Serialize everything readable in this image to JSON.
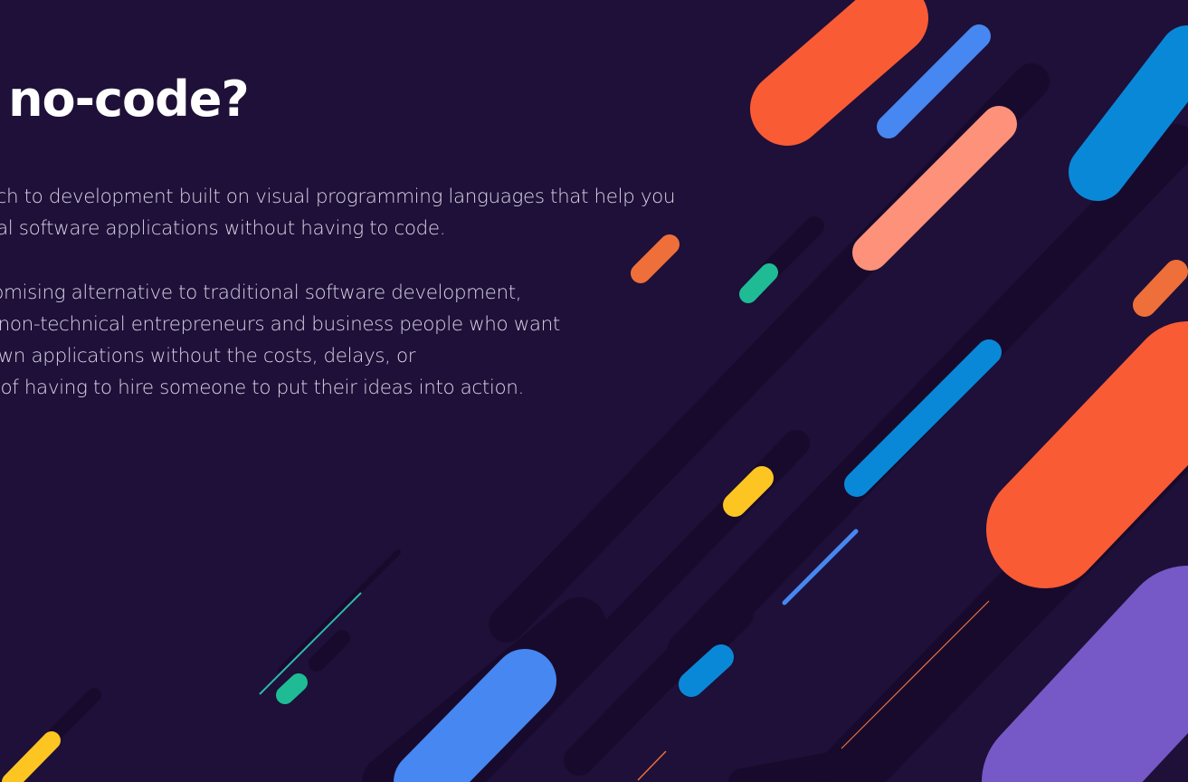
{
  "slide": {
    "title": "t is no-code?",
    "paragraph_1": [
      "oach to development built on visual programming languages that help you",
      "onal software applications without having to code."
    ],
    "paragraph_2": [
      "promising alternative to traditional software development,",
      "or non-technical entrepreneurs and business people who want",
      "r own applications without the costs, delays, or",
      "ns of having to hire someone to put their ideas into action."
    ]
  },
  "colors": {
    "background": "#1e1038",
    "orange": "#f95b35",
    "blue": "#4687f2",
    "salmon": "#fd917a",
    "cyan_blue": "#0a88d8",
    "green": "#1fbb95",
    "yellow": "#fcc522",
    "purple": "#7658c6",
    "orange_dark": "#ee6f3a"
  }
}
